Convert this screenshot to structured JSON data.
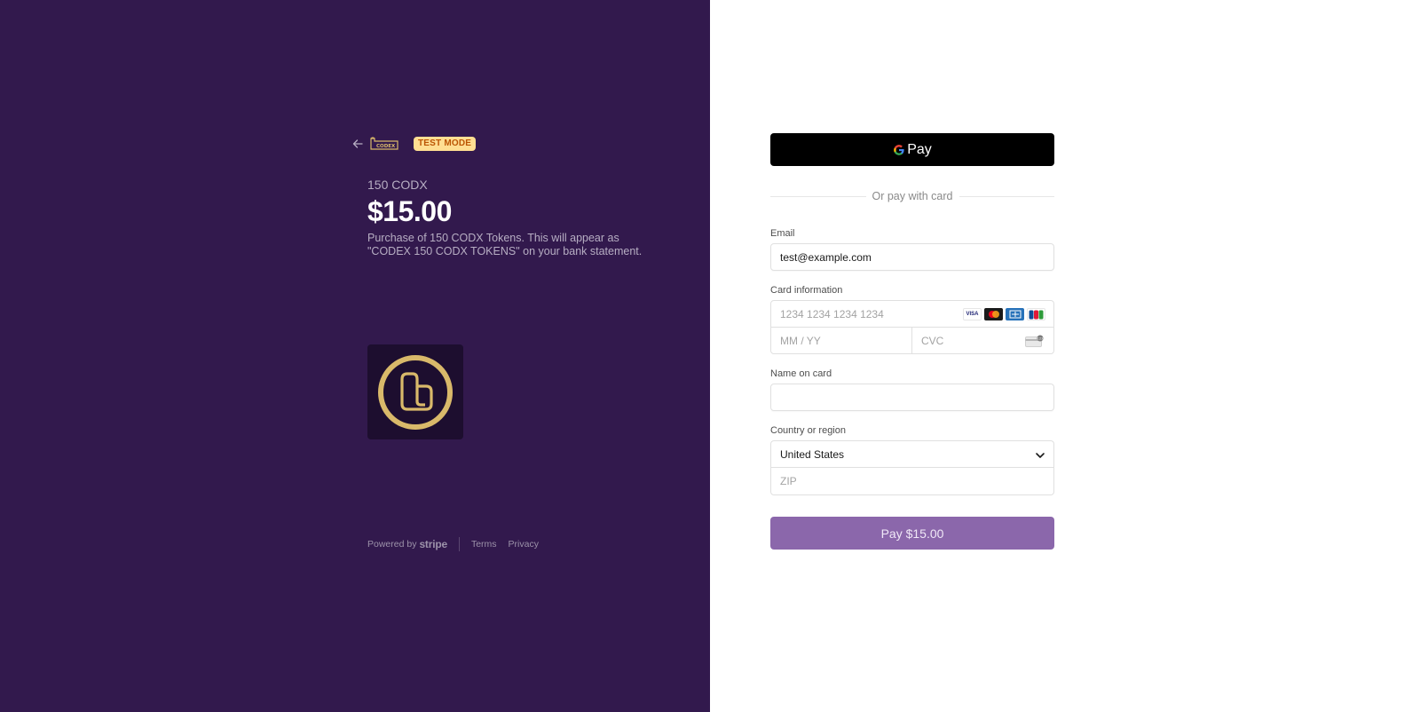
{
  "header": {
    "brand_logo_text": "CODEX",
    "test_badge": "TEST MODE"
  },
  "product": {
    "name": "150 CODX",
    "price": "$15.00",
    "description": "Purchase of 150 CODX Tokens. This will appear as \"CODEX 150 CODX TOKENS\" on your bank statement."
  },
  "footer": {
    "powered_by": "Powered by",
    "stripe": "stripe",
    "terms": "Terms",
    "privacy": "Privacy"
  },
  "payment": {
    "gpay_label": "Pay",
    "divider_text": "Or pay with card",
    "email_label": "Email",
    "email_value": "test@example.com",
    "card_label": "Card information",
    "card_number_placeholder": "1234 1234 1234 1234",
    "expiry_placeholder": "MM / YY",
    "cvc_placeholder": "CVC",
    "card_brands": [
      "VISA",
      "mastercard-icon",
      "amex-icon",
      "jcb-icon"
    ],
    "name_label": "Name on card",
    "name_value": "",
    "country_label": "Country or region",
    "country_value": "United States",
    "zip_placeholder": "ZIP",
    "pay_button": "Pay $15.00"
  },
  "colors": {
    "left_background": "#32194d",
    "badge_background": "#ffde92",
    "badge_text": "#bb5504",
    "pay_button": "#8b67ab",
    "logo_gold": "#d9b96a"
  }
}
